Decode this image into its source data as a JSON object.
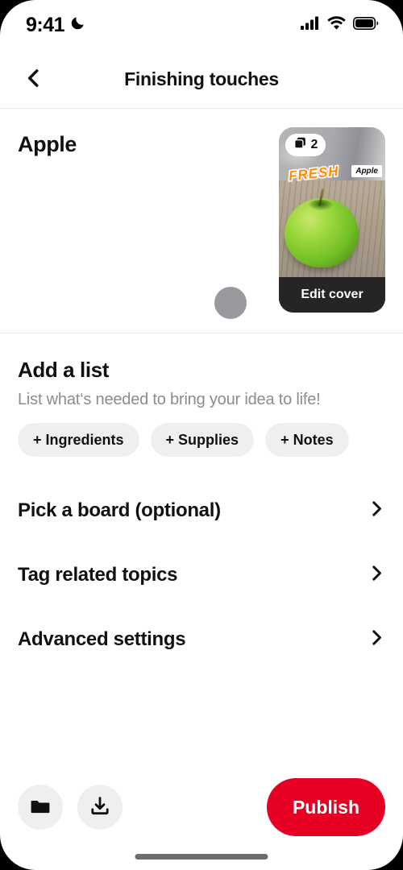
{
  "status_bar": {
    "time": "9:41",
    "dnd_icon": "moon-icon",
    "signal_icon": "cellular-signal-icon",
    "wifi_icon": "wifi-icon",
    "battery_icon": "battery-icon"
  },
  "header": {
    "back_icon": "chevron-left-icon",
    "title": "Finishing touches"
  },
  "preview": {
    "pin_title": "Apple",
    "avatar": "avatar-placeholder",
    "thumbnail": {
      "pages_badge_icon": "pages-stack-icon",
      "pages_count": "2",
      "sticker_text": "FRESH",
      "label_text": "Apple",
      "edit_cover_label": "Edit cover"
    }
  },
  "add_list": {
    "title": "Add a list",
    "subtitle": "List what‘s needed to bring your idea to life!",
    "chips": [
      {
        "label": "+ Ingredients",
        "name": "chip-ingredients"
      },
      {
        "label": "+ Supplies",
        "name": "chip-supplies"
      },
      {
        "label": "+ Notes",
        "name": "chip-notes"
      }
    ]
  },
  "nav_rows": [
    {
      "label": "Pick a board (optional)",
      "name": "nav-row-pick-a-board"
    },
    {
      "label": "Tag related topics",
      "name": "nav-row-tag-related-topics"
    },
    {
      "label": "Advanced settings",
      "name": "nav-row-advanced-settings"
    }
  ],
  "bottom_bar": {
    "folder_icon": "folder-icon",
    "download_icon": "download-icon",
    "publish_label": "Publish"
  },
  "colors": {
    "brand_red": "#e60023",
    "chip_bg": "#efefef",
    "text_primary": "#111111",
    "text_secondary": "#8c8c8c",
    "edit_cover_bg": "#262524",
    "avatar_gray": "#9a9a9e"
  }
}
